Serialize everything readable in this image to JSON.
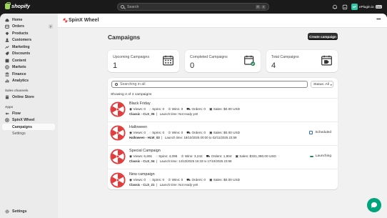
{
  "topbar": {
    "logo": "shopify",
    "search_placeholder": "Search",
    "shortcut": [
      "⌘",
      "K"
    ],
    "store_initials": "eP",
    "store_name": "ePlugin.io",
    "store_tag": "Dev"
  },
  "sidebar": {
    "items": [
      {
        "label": "Home",
        "icon": "home-icon"
      },
      {
        "label": "Orders",
        "icon": "orders-icon",
        "badge": "7"
      },
      {
        "label": "Products",
        "icon": "products-icon"
      },
      {
        "label": "Customers",
        "icon": "customers-icon"
      },
      {
        "label": "Marketing",
        "icon": "marketing-icon"
      },
      {
        "label": "Discounts",
        "icon": "discounts-icon"
      },
      {
        "label": "Content",
        "icon": "content-icon"
      },
      {
        "label": "Markets",
        "icon": "markets-icon"
      },
      {
        "label": "Finance",
        "icon": "finance-icon"
      },
      {
        "label": "Analytics",
        "icon": "analytics-icon"
      }
    ],
    "sales_channels_label": "Sales channels",
    "online_store": "Online Store",
    "apps_label": "Apps",
    "apps": [
      {
        "label": "Flow"
      },
      {
        "label": "SpinX Wheel"
      }
    ],
    "app_sub": [
      {
        "label": "Campaigns",
        "active": true
      },
      {
        "label": "Settings"
      }
    ],
    "settings": "Settings"
  },
  "app": {
    "title": "SpinX Wheel",
    "page_title": "Campaigns",
    "create_button": "Create campaign"
  },
  "stats": [
    {
      "label": "Upcoming Campaigns",
      "value": "1",
      "icon": "calendar-icon"
    },
    {
      "label": "Completed Campaigns",
      "value": "0",
      "icon": "calendar-check-icon"
    },
    {
      "label": "Total Campaigns",
      "value": "4",
      "icon": "calendar-tag-icon"
    }
  ],
  "list": {
    "search_placeholder": "Searching in all",
    "status_filter": "Status: All",
    "showing": "Showing 4 of 4 campaigns"
  },
  "campaigns": [
    {
      "name": "Black Friday",
      "views": "Views: 0",
      "spins": "Spins: 0",
      "wins": "Wins: 0",
      "orders": "Orders: 0",
      "sales": "Sales: $0.00 USD",
      "code": "Classic - CLS_06",
      "launch": "Launch time:  Not ready yet!",
      "status": ""
    },
    {
      "name": "Halloween",
      "views": "Views: 0",
      "spins": "Spins: 0",
      "wins": "Wins: 0",
      "orders": "Orders: 0",
      "sales": "Sales: $0.00 USD",
      "code": "Halloween - HLW_03",
      "launch": "Launch time:  18/10/2025 00:00  to  02/11/2025 23:59",
      "status": "Scheduled"
    },
    {
      "name": "Special Campaign",
      "views": "Views: 6,691",
      "spins": "Spins: 4,095",
      "wins": "Wins: 3,242",
      "orders": "Orders: 1,904",
      "sales": "Sales: $321,380.00 USD",
      "code": "Classic - CLS_04",
      "launch": "Launch time:  14/10/2025 16:33  to  17/10/2025 23:59",
      "status": "Launching"
    },
    {
      "name": "New campaign",
      "views": "Views: 0",
      "spins": "Spins: 0",
      "wins": "Wins: 0",
      "orders": "Orders: 0",
      "sales": "Sales: $0.00 USD",
      "code": "Classic - CLS_21",
      "launch": "Launch time:  Not ready yet!",
      "status": ""
    }
  ],
  "colors": {
    "accent_dark": "#303030",
    "wheel_red": "#e23b3b",
    "scheduled": "#2c6ecb",
    "launching": "#29845a",
    "chat_fab": "#00a47c"
  }
}
